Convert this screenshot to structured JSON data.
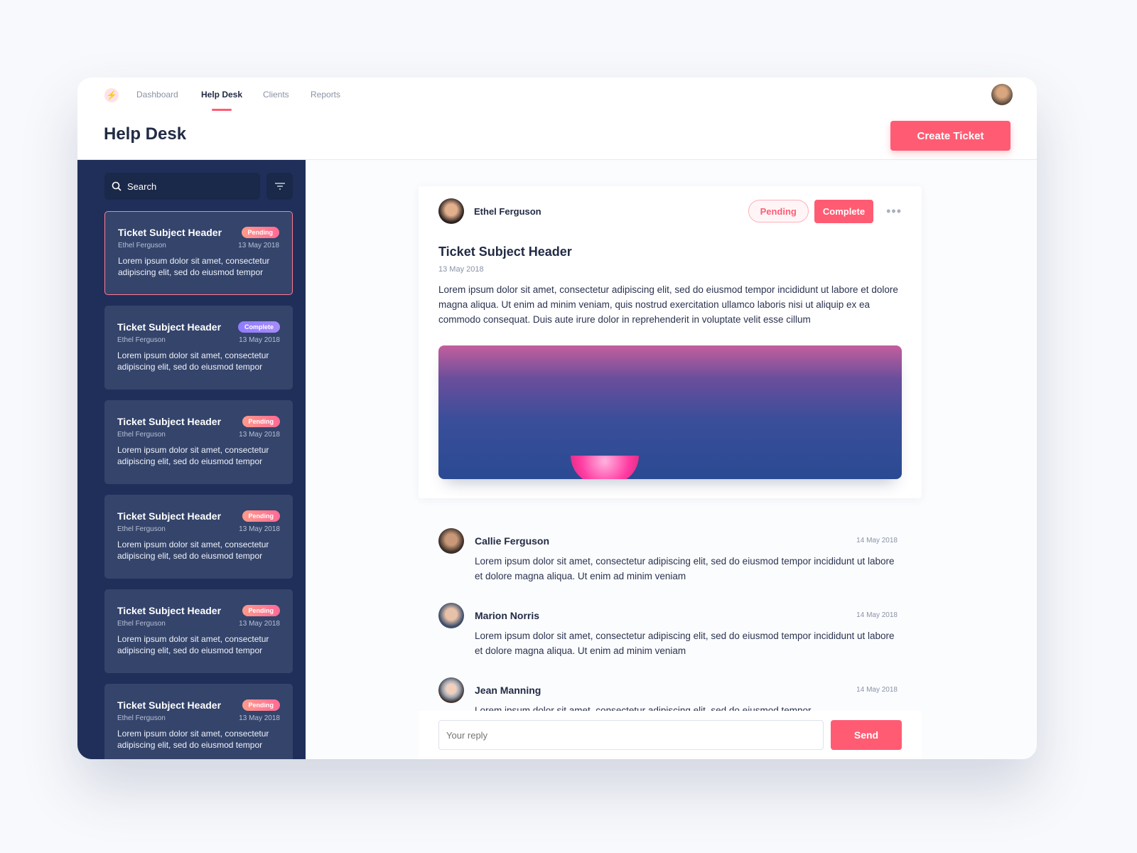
{
  "nav": {
    "items": [
      {
        "label": "Dashboard"
      },
      {
        "label": "Help Desk",
        "active": true
      },
      {
        "label": "Clients"
      },
      {
        "label": "Reports"
      }
    ]
  },
  "header": {
    "title": "Help Desk",
    "create_label": "Create Ticket"
  },
  "sidebar": {
    "search_placeholder": "Search",
    "tickets": [
      {
        "title": "Ticket Subject Header",
        "status": "Pending",
        "author": "Ethel Ferguson",
        "date": "13 May 2018",
        "preview": "Lorem ipsum dolor sit amet, consectetur adipiscing elit, sed do eiusmod tempor",
        "selected": true
      },
      {
        "title": "Ticket Subject Header",
        "status": "Complete",
        "author": "Ethel Ferguson",
        "date": "13 May 2018",
        "preview": "Lorem ipsum dolor sit amet, consectetur adipiscing elit, sed do eiusmod tempor"
      },
      {
        "title": "Ticket Subject Header",
        "status": "Pending",
        "author": "Ethel Ferguson",
        "date": "13 May 2018",
        "preview": "Lorem ipsum dolor sit amet, consectetur adipiscing elit, sed do eiusmod tempor"
      },
      {
        "title": "Ticket Subject Header",
        "status": "Pending",
        "author": "Ethel Ferguson",
        "date": "13 May 2018",
        "preview": "Lorem ipsum dolor sit amet, consectetur adipiscing elit, sed do eiusmod tempor"
      },
      {
        "title": "Ticket Subject Header",
        "status": "Pending",
        "author": "Ethel Ferguson",
        "date": "13 May 2018",
        "preview": "Lorem ipsum dolor sit amet, consectetur adipiscing elit, sed do eiusmod tempor"
      },
      {
        "title": "Ticket Subject Header",
        "status": "Pending",
        "author": "Ethel Ferguson",
        "date": "13 May 2018",
        "preview": "Lorem ipsum dolor sit amet, consectetur adipiscing elit, sed do eiusmod tempor"
      }
    ]
  },
  "detail": {
    "author": "Ethel Ferguson",
    "pending_label": "Pending",
    "complete_label": "Complete",
    "title": "Ticket Subject Header",
    "date": "13 May 2018",
    "body": "Lorem ipsum dolor sit amet, consectetur adipiscing elit, sed do eiusmod tempor incididunt ut labore et dolore magna aliqua. Ut enim ad minim veniam, quis nostrud exercitation ullamco laboris nisi ut aliquip ex ea commodo consequat. Duis aute irure dolor in reprehenderit in voluptate velit esse cillum"
  },
  "comments": [
    {
      "name": "Callie Ferguson",
      "date": "14 May 2018",
      "text": "Lorem ipsum dolor sit amet, consectetur adipiscing elit, sed do eiusmod tempor incididunt ut labore et dolore magna aliqua. Ut enim ad minim veniam"
    },
    {
      "name": "Marion Norris",
      "date": "14 May 2018",
      "text": "Lorem ipsum dolor sit amet, consectetur adipiscing elit, sed do eiusmod tempor incididunt ut labore et dolore magna aliqua. Ut enim ad minim veniam"
    },
    {
      "name": "Jean Manning",
      "date": "14 May 2018",
      "text": "Lorem ipsum dolor sit amet, consectetur adipiscing elit, sed do eiusmod tempor"
    }
  ],
  "reply": {
    "placeholder": "Your reply",
    "send_label": "Send"
  },
  "colors": {
    "accent": "#ff5c73",
    "sidebar": "#1f2f5a",
    "card": "#34446b",
    "complete": "#8f7bff"
  }
}
